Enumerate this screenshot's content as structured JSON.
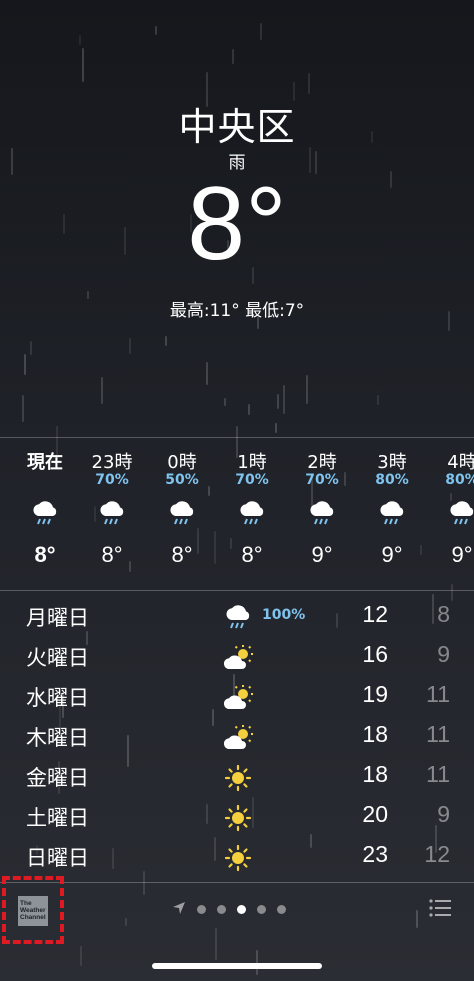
{
  "header": {
    "city": "中央区",
    "condition": "雨",
    "temperature": "8°",
    "high_low": "最高:11° 最低:7°"
  },
  "hourly": [
    {
      "time": "現在",
      "pop": "",
      "icon": "rain-icon",
      "temp": "8°"
    },
    {
      "time": "23時",
      "pop": "70%",
      "icon": "rain-icon",
      "temp": "8°"
    },
    {
      "time": "0時",
      "pop": "50%",
      "icon": "rain-icon",
      "temp": "8°"
    },
    {
      "time": "1時",
      "pop": "70%",
      "icon": "rain-icon",
      "temp": "8°"
    },
    {
      "time": "2時",
      "pop": "70%",
      "icon": "rain-icon",
      "temp": "9°"
    },
    {
      "time": "3時",
      "pop": "80%",
      "icon": "rain-icon",
      "temp": "9°"
    },
    {
      "time": "4時",
      "pop": "80%",
      "icon": "rain-icon",
      "temp": "9°"
    }
  ],
  "daily": [
    {
      "day": "月曜日",
      "icon": "rain-icon",
      "pop": "100%",
      "high": "12",
      "low": "8"
    },
    {
      "day": "火曜日",
      "icon": "partly-cloudy-icon",
      "pop": "",
      "high": "16",
      "low": "9"
    },
    {
      "day": "水曜日",
      "icon": "partly-cloudy-icon",
      "pop": "",
      "high": "19",
      "low": "11"
    },
    {
      "day": "木曜日",
      "icon": "partly-cloudy-icon",
      "pop": "",
      "high": "18",
      "low": "11"
    },
    {
      "day": "金曜日",
      "icon": "sun-icon",
      "pop": "",
      "high": "18",
      "low": "11"
    },
    {
      "day": "土曜日",
      "icon": "sun-icon",
      "pop": "",
      "high": "20",
      "low": "9"
    },
    {
      "day": "日曜日",
      "icon": "sun-icon",
      "pop": "",
      "high": "23",
      "low": "12"
    }
  ],
  "footer": {
    "logo_text": "The Weather Channel",
    "page_count": 5,
    "active_page": 3
  },
  "colors": {
    "precip": "#7fc3ee",
    "sun": "#f5cf3d",
    "highlight": "#e01a22"
  }
}
